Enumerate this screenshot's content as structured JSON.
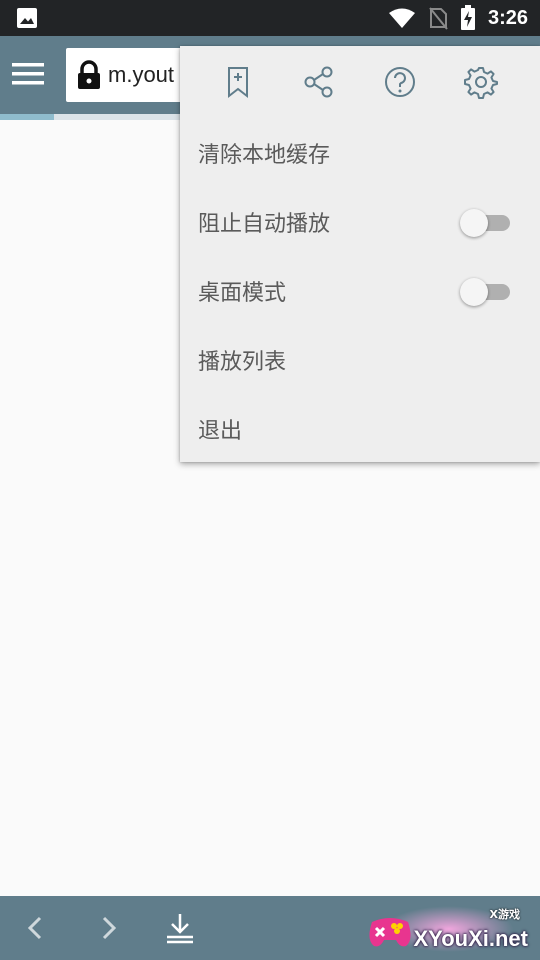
{
  "status_bar": {
    "time": "3:26",
    "icons": [
      "image-icon",
      "wifi-icon",
      "no-sim-icon",
      "battery-charging-icon"
    ]
  },
  "toolbar": {
    "url": "m.yout",
    "icons": [
      "menu-icon",
      "lock-icon"
    ]
  },
  "menu": {
    "top_icons": [
      "bookmark-add-icon",
      "share-icon",
      "help-icon",
      "settings-icon"
    ],
    "items": [
      {
        "label": "清除本地缓存"
      },
      {
        "label": "阻止自动播放",
        "toggle": false
      },
      {
        "label": "桌面模式",
        "toggle": false
      },
      {
        "label": "播放列表"
      },
      {
        "label": "退出"
      }
    ]
  },
  "bottom_bar": {
    "icons": [
      "back-icon",
      "forward-icon",
      "download-icon"
    ]
  },
  "watermark": {
    "text": "XYouXi.net",
    "small_text": "X游戏"
  },
  "colors": {
    "toolbar": "#607d8b",
    "status_bar": "#222426",
    "menu_bg": "#eeeeee",
    "menu_text": "#5a5a5a",
    "icon": "#607d8b"
  }
}
